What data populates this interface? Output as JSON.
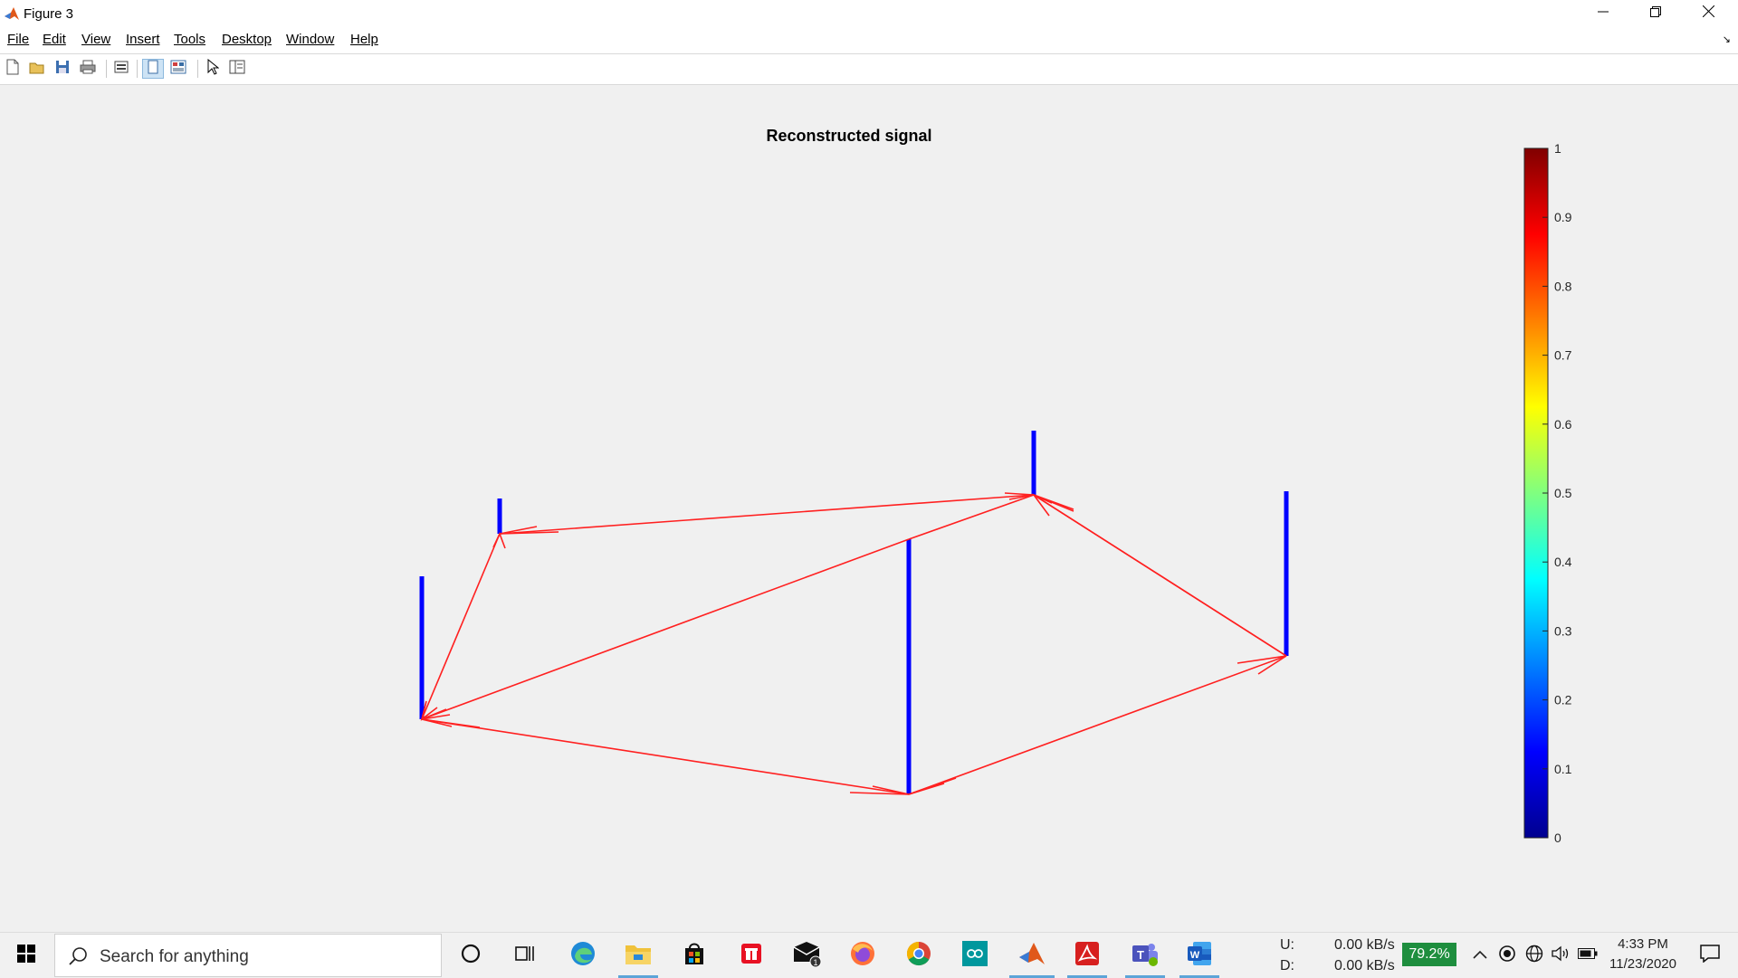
{
  "window": {
    "title": "Figure 3"
  },
  "menu": [
    "File",
    "Edit",
    "View",
    "Insert",
    "Tools",
    "Desktop",
    "Window",
    "Help"
  ],
  "figure": {
    "title": "Reconstructed signal",
    "colorbar": {
      "ticks": [
        "1",
        "0.9",
        "0.8",
        "0.7",
        "0.6",
        "0.5",
        "0.4",
        "0.3",
        "0.2",
        "0.1",
        "0"
      ],
      "colormap": "jet"
    },
    "stem_color": "#0000ff",
    "edge_color": "#ff0000"
  },
  "taskbar": {
    "search_placeholder": "Search for anything",
    "net_up_label": "U:",
    "net_down_label": "D:",
    "net_up_value": "0.00 kB/s",
    "net_down_value": "0.00 kB/s",
    "battery": "79.2%",
    "time": "4:33 PM",
    "date": "11/23/2020"
  }
}
